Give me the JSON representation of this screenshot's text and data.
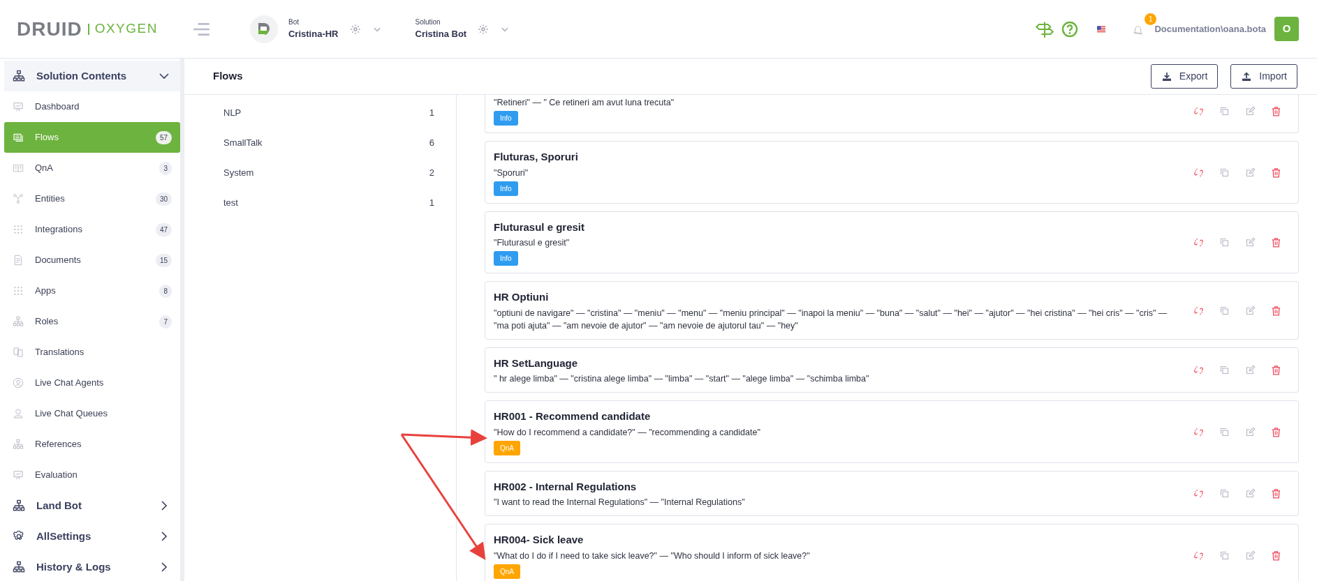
{
  "header": {
    "brand": "DRUID",
    "product": "OXYGEN",
    "selectors": [
      {
        "label": "Bot",
        "value": "Cristina-HR"
      },
      {
        "label": "Solution",
        "value": "Cristina Bot"
      }
    ],
    "notifications": "1",
    "user": "Documentation\\oana.bota",
    "avatar": "O"
  },
  "sidebar": {
    "sections": [
      {
        "label": "Solution Contents",
        "expanded": true,
        "items": [
          {
            "label": "Dashboard",
            "selected": false
          },
          {
            "label": "Flows",
            "count": "57",
            "selected": true
          },
          {
            "label": "QnA",
            "count": "3",
            "selected": false
          },
          {
            "label": "Entities",
            "count": "30",
            "selected": false
          },
          {
            "label": "Integrations",
            "count": "47",
            "selected": false
          },
          {
            "label": "Documents",
            "count": "15",
            "selected": false
          },
          {
            "label": "Apps",
            "count": "8",
            "selected": false
          },
          {
            "label": "Roles",
            "count": "7",
            "selected": false
          },
          {
            "label": "Translations",
            "selected": false
          },
          {
            "label": "Live Chat Agents",
            "selected": false
          },
          {
            "label": "Live Chat Queues",
            "selected": false
          },
          {
            "label": "References",
            "selected": false
          },
          {
            "label": "Evaluation",
            "selected": false
          }
        ]
      },
      {
        "label": "Land Bot",
        "expanded": false
      },
      {
        "label": "AllSettings",
        "expanded": false
      },
      {
        "label": "History & Logs",
        "expanded": false
      }
    ]
  },
  "page": {
    "title": "Flows",
    "buttons": [
      "Export",
      "Import"
    ]
  },
  "categories": [
    {
      "name": "NLP",
      "count": "1"
    },
    {
      "name": "SmallTalk",
      "count": "6"
    },
    {
      "name": "System",
      "count": "2"
    },
    {
      "name": "test",
      "count": "1"
    }
  ],
  "flows": [
    {
      "phrases": "\"Retineri\" — \" Ce retineri am avut luna trecuta\"",
      "tag": {
        "label": "Info",
        "kind": "info"
      }
    },
    {
      "title": "Fluturas, Sporuri",
      "phrases": "\"Sporuri\"",
      "tag": {
        "label": "Info",
        "kind": "info"
      }
    },
    {
      "title": "Fluturasul e gresit",
      "phrases": "\"Fluturasul e gresit\"",
      "tag": {
        "label": "Info",
        "kind": "info"
      }
    },
    {
      "title": "HR Optiuni",
      "phrases": "\"optiuni de navigare\" — \"cristina\" — \"meniu\" — \"menu\" — \"meniu principal\" — \"inapoi la meniu\" — \"buna\" — \"salut\" — \"hei\" — \"ajutor\" — \"hei cristina\" — \"hei cris\" — \"cris\" — \"ma poti ajuta\" — \"am nevoie de ajutor\" — \"am nevoie de ajutorul tau\" — \"hey\""
    },
    {
      "title": "HR SetLanguage",
      "phrases": "\" hr alege limba\" — \"cristina alege limba\" — \"limba\" — \"start\" — \"alege limba\" — \"schimba limba\""
    },
    {
      "title": "HR001 - Recommend candidate",
      "phrases": "\"How do I recommend a candidate?\" — \"recommending a candidate\"",
      "tag": {
        "label": "QnA",
        "kind": "qna"
      }
    },
    {
      "title": "HR002 - Internal Regulations",
      "phrases": "\"I want to read the Internal Regulations\" — \"Internal Regulations\""
    },
    {
      "title": "HR004- Sick leave",
      "phrases": "\"What do I do if I need to take sick leave?\" — \"Who should I inform of sick leave?\"",
      "tag": {
        "label": "QnA",
        "kind": "qna"
      }
    }
  ]
}
